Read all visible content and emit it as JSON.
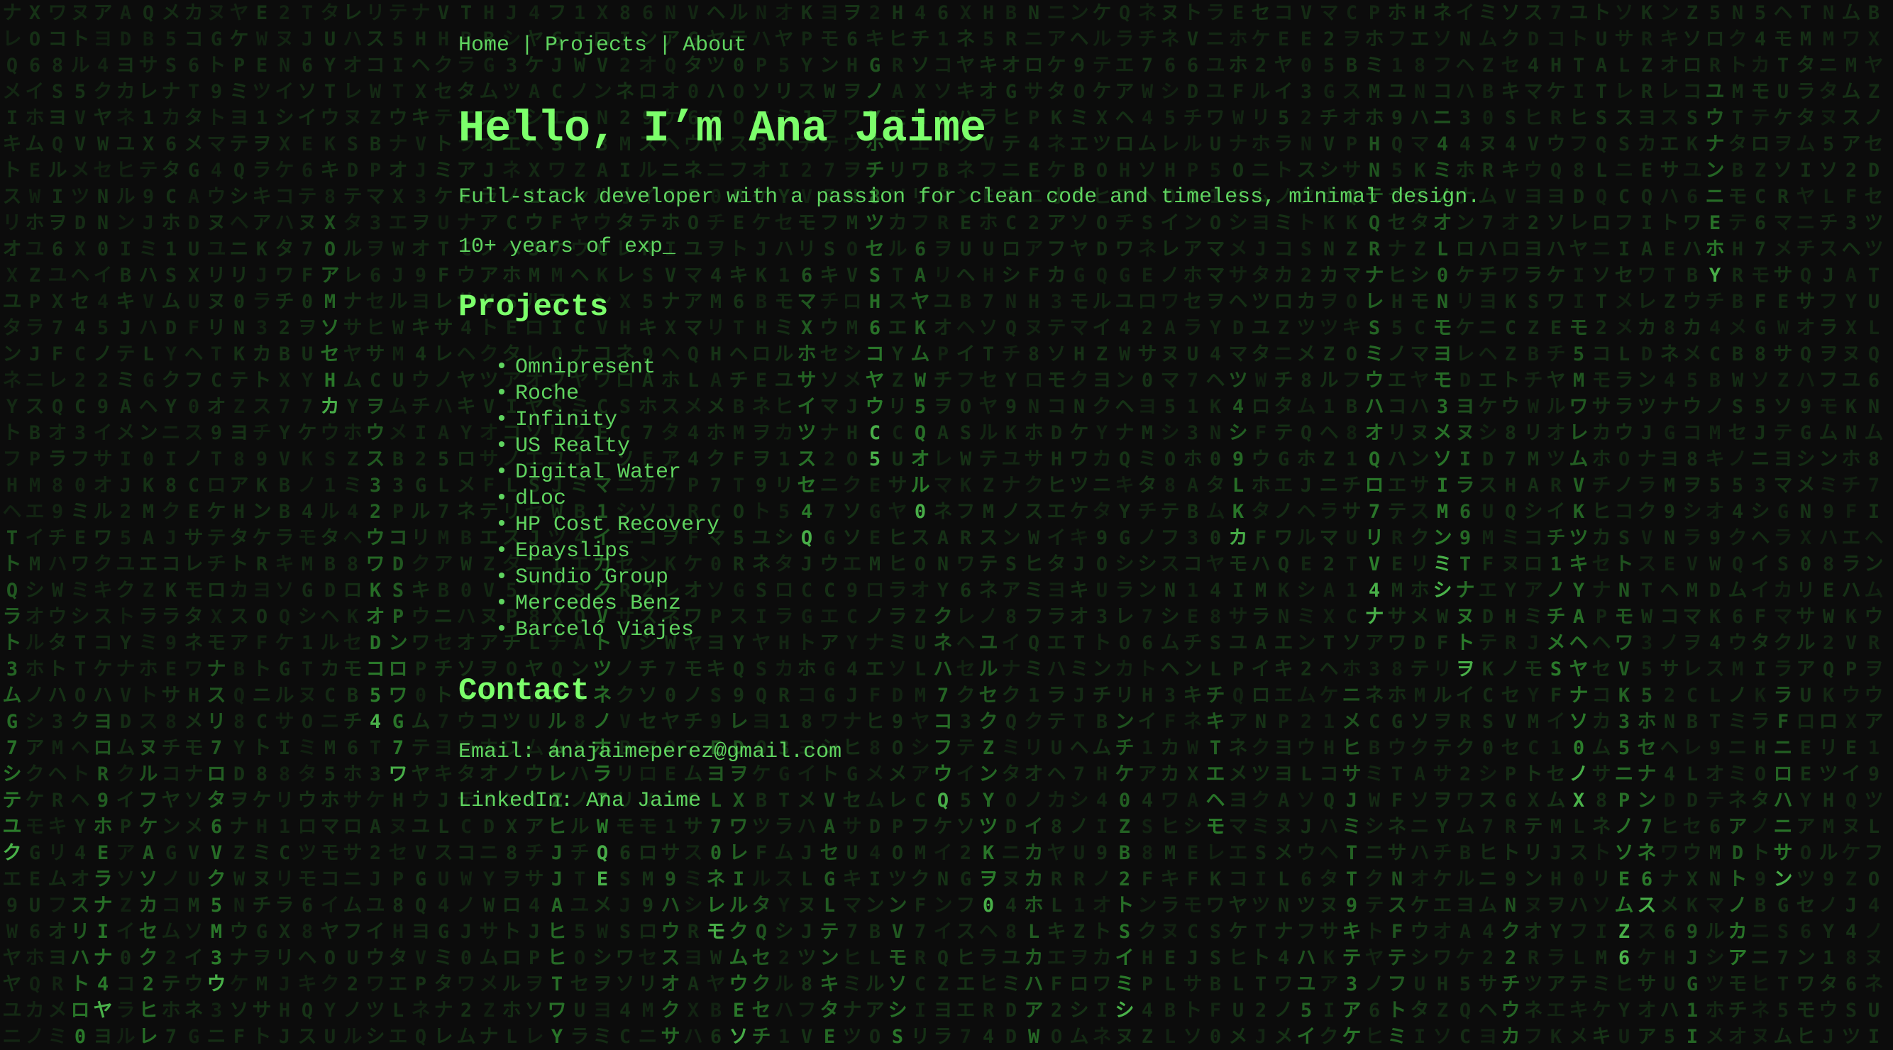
{
  "nav": {
    "home": "Home",
    "projects": "Projects",
    "about": "About",
    "separator": "|"
  },
  "hero": {
    "title": "Hello, I’m Ana Jaime",
    "tagline": "Full-stack developer with a passion for clean code and timeless, minimal design.",
    "typing_text": "10+ years of exp_"
  },
  "projects": {
    "heading": "Projects",
    "items": [
      "Omnipresent",
      "Roche",
      "Infinity",
      "US Realty",
      "Digital Water",
      "dLoc",
      "HP Cost Recovery",
      "Epayslips",
      "Sundio Group",
      "Mercedes Benz",
      "Barceló Viajes"
    ]
  },
  "contact": {
    "heading": "Contact",
    "email_label": "Email:",
    "email_value": "anajaimeperez@gmail.com",
    "linkedin_label": "LinkedIn:",
    "linkedin_value": "Ana Jaime"
  },
  "theme": {
    "background": "#0c0c0c",
    "heading_color": "#7cff6b",
    "text_color": "#5fd35f",
    "rain_dim": "#1c4a1c",
    "rain_bright": "#3da63d"
  },
  "background_effect": "matrix-code-rain"
}
